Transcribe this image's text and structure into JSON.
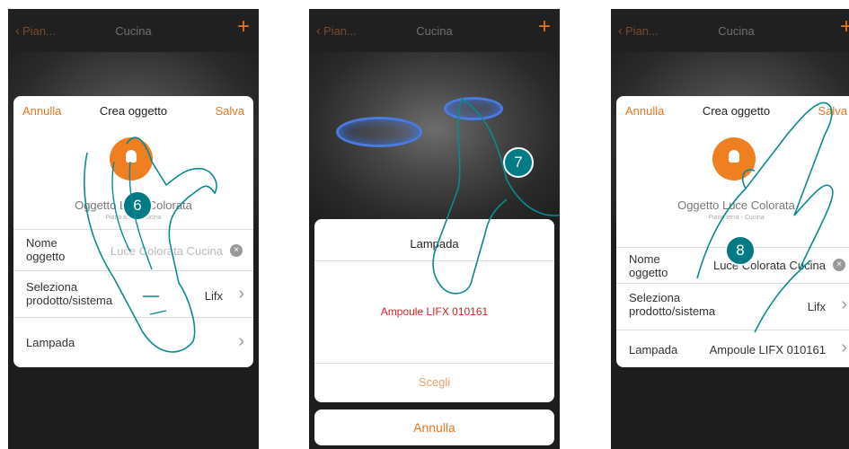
{
  "nav": {
    "back_label": "Pian...",
    "title": "Cucina",
    "plus": "+"
  },
  "dialog": {
    "cancel": "Annulla",
    "title": "Crea oggetto",
    "save": "Salva",
    "object_name": "Oggetto Luce Colorata",
    "location": "Piano terra - Cucina",
    "rows": {
      "name_key": "Nome oggetto",
      "name_value": "Luce Colorata Cucina",
      "product_key": "Seleziona prodotto/sistema",
      "product_value": "Lifx",
      "lamp_key": "Lampada",
      "lamp_value": "Ampoule LIFX 010161"
    }
  },
  "picker": {
    "title": "Lampada",
    "selected": "Ampoule LIFX 010161",
    "choose": "Scegli",
    "cancel": "Annulla"
  },
  "steps": [
    "6",
    "7",
    "8"
  ],
  "colors": {
    "accent": "#e8761e",
    "step_badge": "#007a83",
    "selected": "#d62020"
  }
}
